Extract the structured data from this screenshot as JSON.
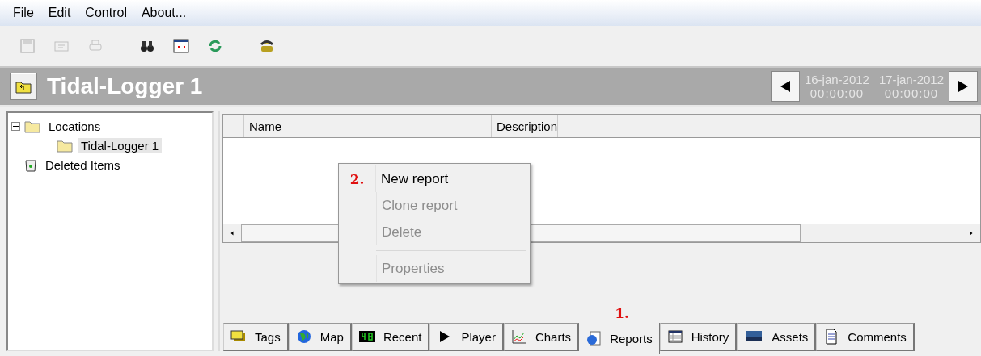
{
  "menu_bar": [
    "File",
    "Edit",
    "Control",
    "About..."
  ],
  "toolbar": [
    {
      "disabled": true
    },
    {
      "disabled": true
    },
    {
      "disabled": true
    },
    {
      "disabled": false
    },
    {
      "disabled": false
    },
    {
      "disabled": false
    },
    {
      "disabled": false
    }
  ],
  "header": {
    "title": "Tidal-Logger 1",
    "range": [
      {
        "date": "16-jan-2012",
        "time": "00:00:00"
      },
      {
        "date": "17-jan-2012",
        "time": "00:00:00"
      }
    ]
  },
  "tree": [
    {
      "label": "Locations",
      "expanded": true,
      "selected": false,
      "children": [
        {
          "label": "Tidal-Logger 1",
          "selected": true
        }
      ]
    },
    {
      "label": "Deleted Items",
      "selected": false
    }
  ],
  "table": {
    "columns": [
      "Name",
      "Description"
    ]
  },
  "context_menu": {
    "annotation": "2.",
    "items": [
      {
        "kind": "item",
        "label": "New report",
        "disabled": false
      },
      {
        "kind": "item",
        "label": "Clone report",
        "disabled": true
      },
      {
        "kind": "item",
        "label": "Delete",
        "disabled": true
      },
      {
        "kind": "separator"
      },
      {
        "kind": "item",
        "label": "Properties",
        "disabled": true
      }
    ]
  },
  "tabs": [
    {
      "label": "Tags",
      "selected": false
    },
    {
      "label": "Map",
      "selected": false
    },
    {
      "label": "Recent",
      "selected": false
    },
    {
      "label": "Player",
      "selected": false
    },
    {
      "label": "Charts",
      "selected": false
    },
    {
      "label": "Reports",
      "selected": true,
      "annotation": "1."
    },
    {
      "label": "History",
      "selected": false
    },
    {
      "label": "Assets",
      "selected": false
    },
    {
      "label": "Comments",
      "selected": false
    }
  ]
}
